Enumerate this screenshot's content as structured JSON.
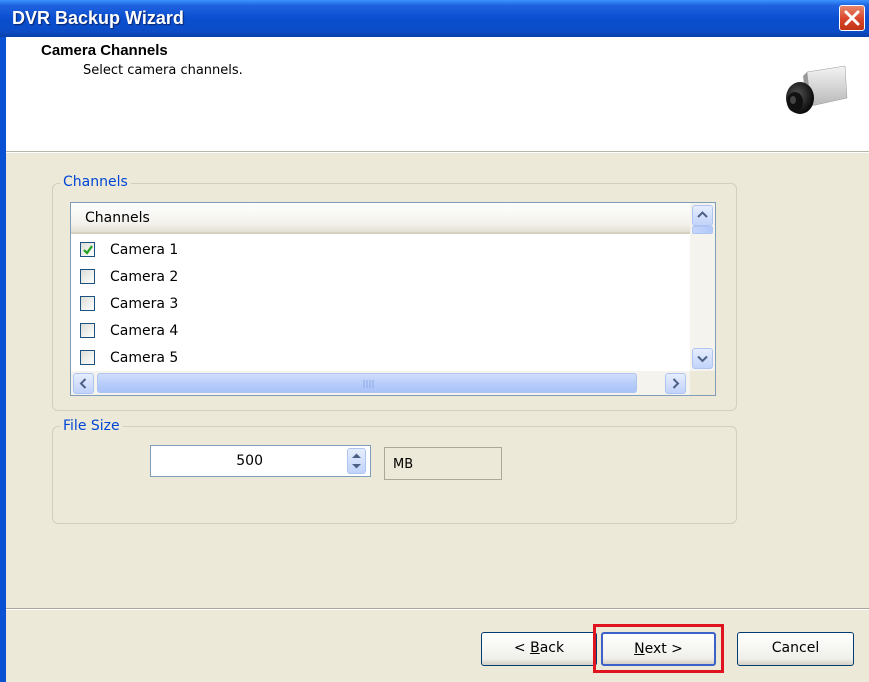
{
  "window": {
    "title": "DVR Backup Wizard",
    "close_icon": "close-icon"
  },
  "header": {
    "title": "Camera Channels",
    "subtitle": "Select camera channels.",
    "image_icon": "camera-icon"
  },
  "channels_group": {
    "label": "Channels",
    "column_header": "Channels",
    "items": [
      {
        "label": "Camera 1",
        "checked": true
      },
      {
        "label": "Camera 2",
        "checked": false
      },
      {
        "label": "Camera 3",
        "checked": false
      },
      {
        "label": "Camera 4",
        "checked": false
      },
      {
        "label": "Camera 5",
        "checked": false
      }
    ]
  },
  "file_size_group": {
    "label": "File Size",
    "value": "500",
    "unit": "MB"
  },
  "buttons": {
    "back_prefix": "< ",
    "back_access": "B",
    "back_rest": "ack",
    "next_access": "N",
    "next_rest": "ext >",
    "cancel": "Cancel"
  },
  "colors": {
    "titlebar": "#0A4FD0",
    "group_label": "#0046D5",
    "highlight": "#E0141E"
  }
}
